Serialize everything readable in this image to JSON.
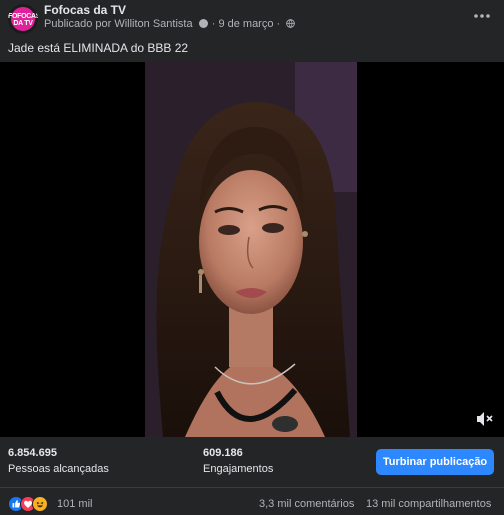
{
  "post": {
    "page_name": "Fofocas da TV",
    "avatar_text": "FOFOCAS DA TV",
    "published_prefix": "Publicado por Williton Santista",
    "date": "9 de março",
    "separator": "·",
    "caption": "Jade está ELIMINADA do BBB 22"
  },
  "icons": {
    "more": "more-horizontal-icon",
    "mute": "speaker-muted-icon",
    "globe": "globe-icon"
  },
  "stats": {
    "reach_value": "6.854.695",
    "reach_label": "Pessoas alcançadas",
    "engagement_value": "609.186",
    "engagement_label": "Engajamentos",
    "boost_label": "Turbinar publicação"
  },
  "reactions": {
    "count": "101 mil",
    "types": [
      "like",
      "love",
      "haha"
    ],
    "comments": "3,3 mil comentários",
    "shares": "13 mil compartilhamentos"
  },
  "colors": {
    "background": "#242526",
    "primary_text": "#e4e6eb",
    "secondary_text": "#b0b3b8",
    "accent": "#2d88ff",
    "like": "#1877f2",
    "love": "#f33e58",
    "haha": "#f7b125"
  }
}
